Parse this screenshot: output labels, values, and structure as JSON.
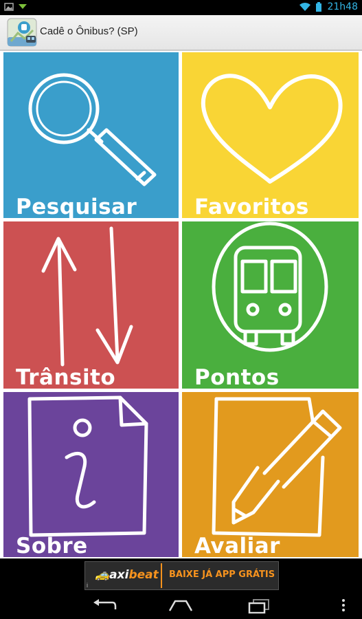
{
  "status_bar": {
    "time": "21h48"
  },
  "action_bar": {
    "title": "Cadê o Ônibus? (SP)"
  },
  "tiles": [
    {
      "label": "Pesquisar",
      "icon": "magnifier-icon",
      "color": "#3a9ecb"
    },
    {
      "label": "Favoritos",
      "icon": "heart-icon",
      "color": "#f9d535"
    },
    {
      "label": "Trânsito",
      "icon": "traffic-arrows-icon",
      "color": "#cc5152"
    },
    {
      "label": "Pontos",
      "icon": "bus-icon",
      "color": "#4aaf3e"
    },
    {
      "label": "Sobre",
      "icon": "info-icon",
      "color": "#6b449b"
    },
    {
      "label": "Avaliar",
      "icon": "pencil-icon",
      "color": "#e29a1e"
    }
  ],
  "ad": {
    "brand_prefix": "axi",
    "brand_suffix": "beat",
    "cta": "BAIXE JÁ APP GRÁTIS",
    "info": "i"
  }
}
